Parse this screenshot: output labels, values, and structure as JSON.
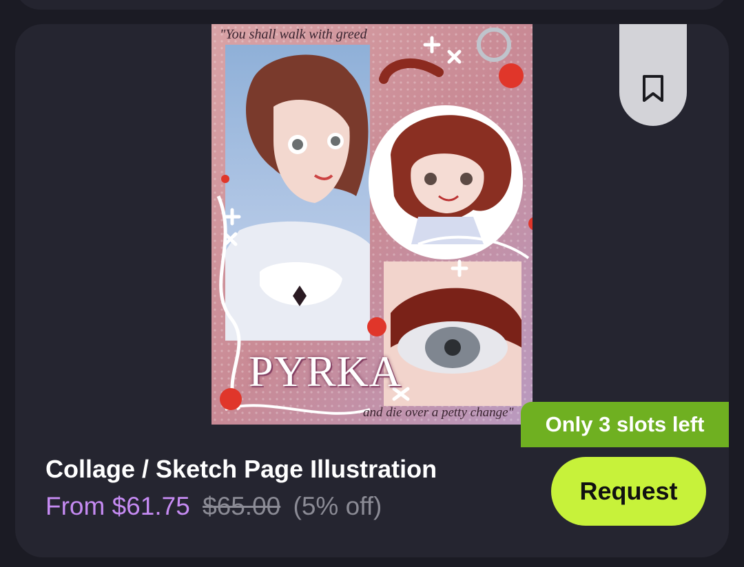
{
  "listing": {
    "artwork": {
      "quote_top": "\"You shall walk with greed",
      "title_text": "PYRKA",
      "quote_bottom": "and die over a petty change\""
    },
    "bookmark": {
      "icon": "bookmark-icon"
    },
    "slots_badge": "Only 3 slots left",
    "title": "Collage / Sketch Page Illustration",
    "price": {
      "current": "From $61.75",
      "original": "$65.00",
      "discount": "(5% off)"
    },
    "request_label": "Request"
  },
  "colors": {
    "page_bg": "#1b1b24",
    "card_bg": "#252530",
    "accent_green": "#c7f23a",
    "badge_green": "#6fb021",
    "price_purple": "#c68bf3",
    "muted_text": "#8b8b95"
  }
}
